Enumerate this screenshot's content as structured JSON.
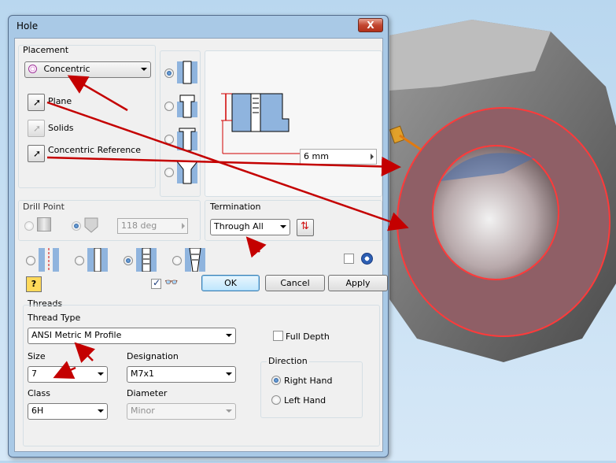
{
  "dialog": {
    "title": "Hole",
    "close_label": "X"
  },
  "placement": {
    "group_label": "Placement",
    "type_value": "Concentric",
    "plane_label": "Plane",
    "solids_label": "Solids",
    "concentric_ref_label": "Concentric Reference"
  },
  "preview": {
    "depth_value": "6 mm"
  },
  "drill_point": {
    "group_label": "Drill Point",
    "angle_value": "118 deg"
  },
  "termination": {
    "group_label": "Termination",
    "value": "Through All"
  },
  "buttons": {
    "ok": "OK",
    "cancel": "Cancel",
    "apply": "Apply",
    "help": "?"
  },
  "threads": {
    "group_label": "Threads",
    "thread_type_label": "Thread Type",
    "thread_type_value": "ANSI Metric M Profile",
    "full_depth_label": "Full Depth",
    "size_label": "Size",
    "size_value": "7",
    "designation_label": "Designation",
    "designation_value": "M7x1",
    "class_label": "Class",
    "class_value": "6H",
    "diameter_label": "Diameter",
    "diameter_value": "Minor",
    "direction_label": "Direction",
    "right_hand_label": "Right Hand",
    "left_hand_label": "Left Hand"
  },
  "colors": {
    "annotation_arrow": "#c40000",
    "part_face": "#8a5a60",
    "part_edge": "#ff3030",
    "background": "#c6def3"
  }
}
